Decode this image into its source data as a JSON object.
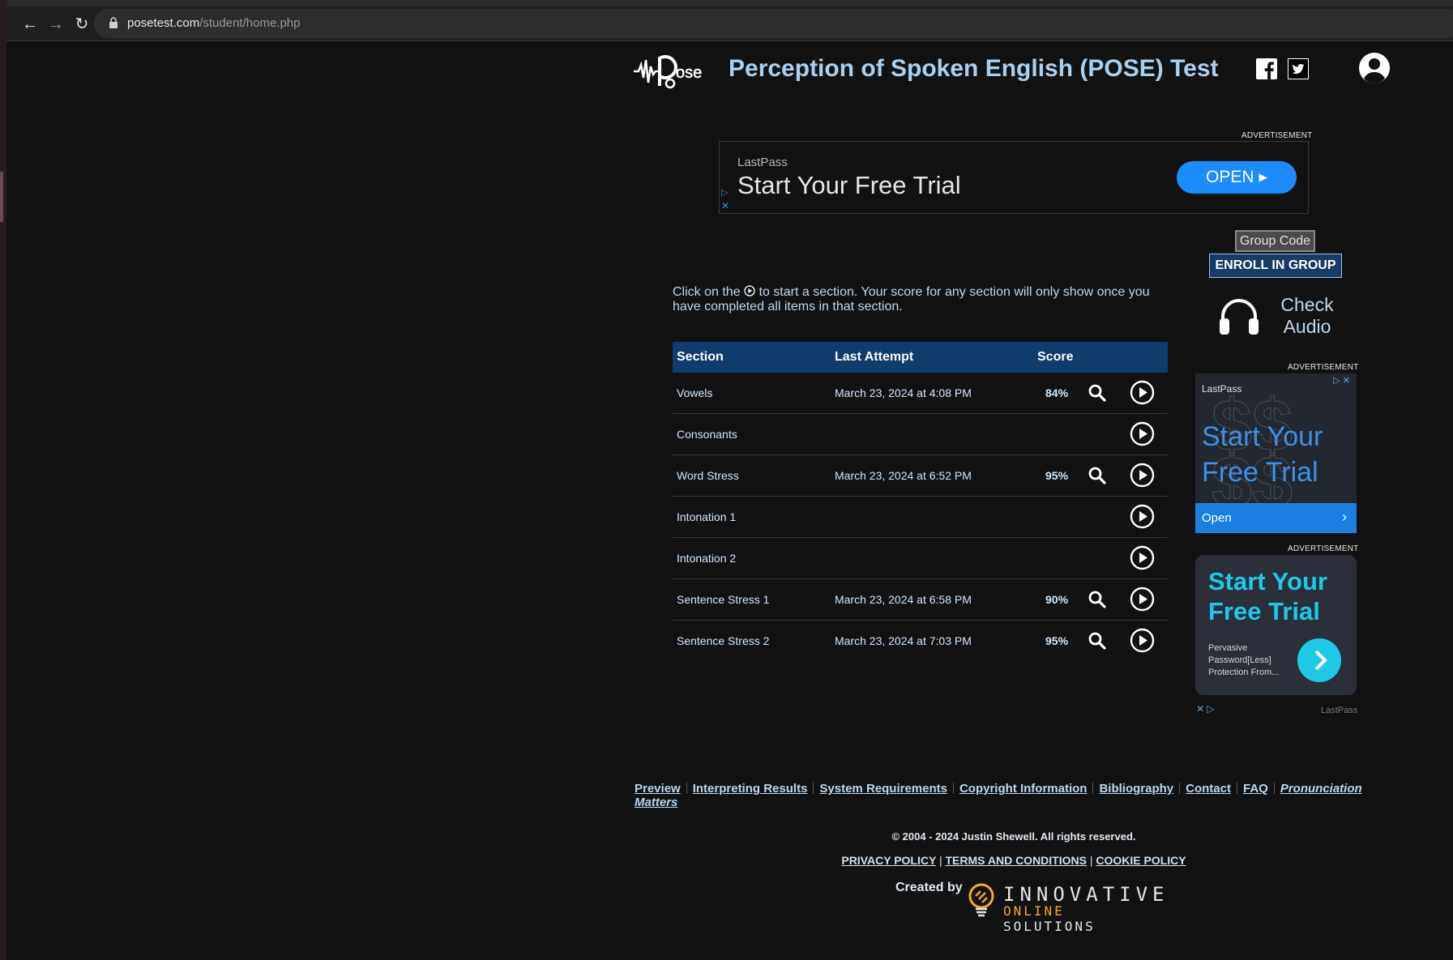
{
  "browser": {
    "url_host": "posetest.com",
    "url_path": "/student/home.php"
  },
  "header": {
    "logo_alt": "POSE",
    "title": "Perception of Spoken English (POSE) Test"
  },
  "ads": {
    "label": "ADVERTISEMENT",
    "top_banner": {
      "brand": "LastPass",
      "headline": "Start Your Free Trial",
      "cta": "OPEN"
    },
    "side_1": {
      "brand": "LastPass",
      "headline": "Start Your Free Trial",
      "cta": "Open"
    },
    "side_2": {
      "headline": "Start Your Free Trial",
      "sub": "Pervasive Password[Less] Protection From...",
      "footer_brand": "LastPass"
    }
  },
  "group": {
    "code_placeholder": "Group Code",
    "enroll_label": "ENROLL IN GROUP",
    "check_audio_label": "Check Audio"
  },
  "instructions": {
    "before": "Click on the",
    "after": "to start a section. Your score for any section will only show once you have completed all items in that section."
  },
  "table": {
    "headers": {
      "section": "Section",
      "last_attempt": "Last Attempt",
      "score": "Score"
    },
    "rows": [
      {
        "section": "Vowels",
        "last_attempt": "March 23, 2024 at 4:08 PM",
        "score": "84%"
      },
      {
        "section": "Consonants",
        "last_attempt": "",
        "score": ""
      },
      {
        "section": "Word Stress",
        "last_attempt": "March 23, 2024 at 6:52 PM",
        "score": "95%"
      },
      {
        "section": "Intonation 1",
        "last_attempt": "",
        "score": ""
      },
      {
        "section": "Intonation 2",
        "last_attempt": "",
        "score": ""
      },
      {
        "section": "Sentence Stress 1",
        "last_attempt": "March 23, 2024 at 6:58 PM",
        "score": "90%"
      },
      {
        "section": "Sentence Stress 2",
        "last_attempt": "March 23, 2024 at 7:03 PM",
        "score": "95%"
      }
    ]
  },
  "footer": {
    "nav": [
      "Preview",
      "Interpreting Results",
      "System Requirements",
      "Copyright Information",
      "Bibliography",
      "Contact",
      "FAQ"
    ],
    "nav_emphasis": "Pronunciation Matters",
    "copyright": "© 2004 - 2024 Justin Shewell. All rights reserved.",
    "legal": [
      "PRIVACY POLICY",
      "TERMS AND CONDITIONS",
      "COOKIE POLICY"
    ],
    "legal_separator": "|",
    "created_by": "Created by",
    "company_line1": "INNOVATIVE",
    "company_line2_accent": "ONLINE",
    "company_line2_rest": "SOLUTIONS"
  },
  "colors": {
    "background": "#121212",
    "accent_blue": "#0f3b6d",
    "title_blue": "#a9d0ee",
    "ad_blue": "#1a8cff",
    "ad_cyan": "#1ec9e8",
    "brand_orange": "#f0a92a"
  },
  "icons": {
    "back": "arrow-left-icon",
    "forward": "arrow-right-icon",
    "reload": "reload-icon",
    "lock": "lock-icon",
    "facebook": "facebook-icon",
    "twitter": "twitter-icon",
    "profile": "user-circle-icon",
    "headphones": "headphones-icon",
    "search": "search-icon",
    "play": "play-circle-icon"
  }
}
